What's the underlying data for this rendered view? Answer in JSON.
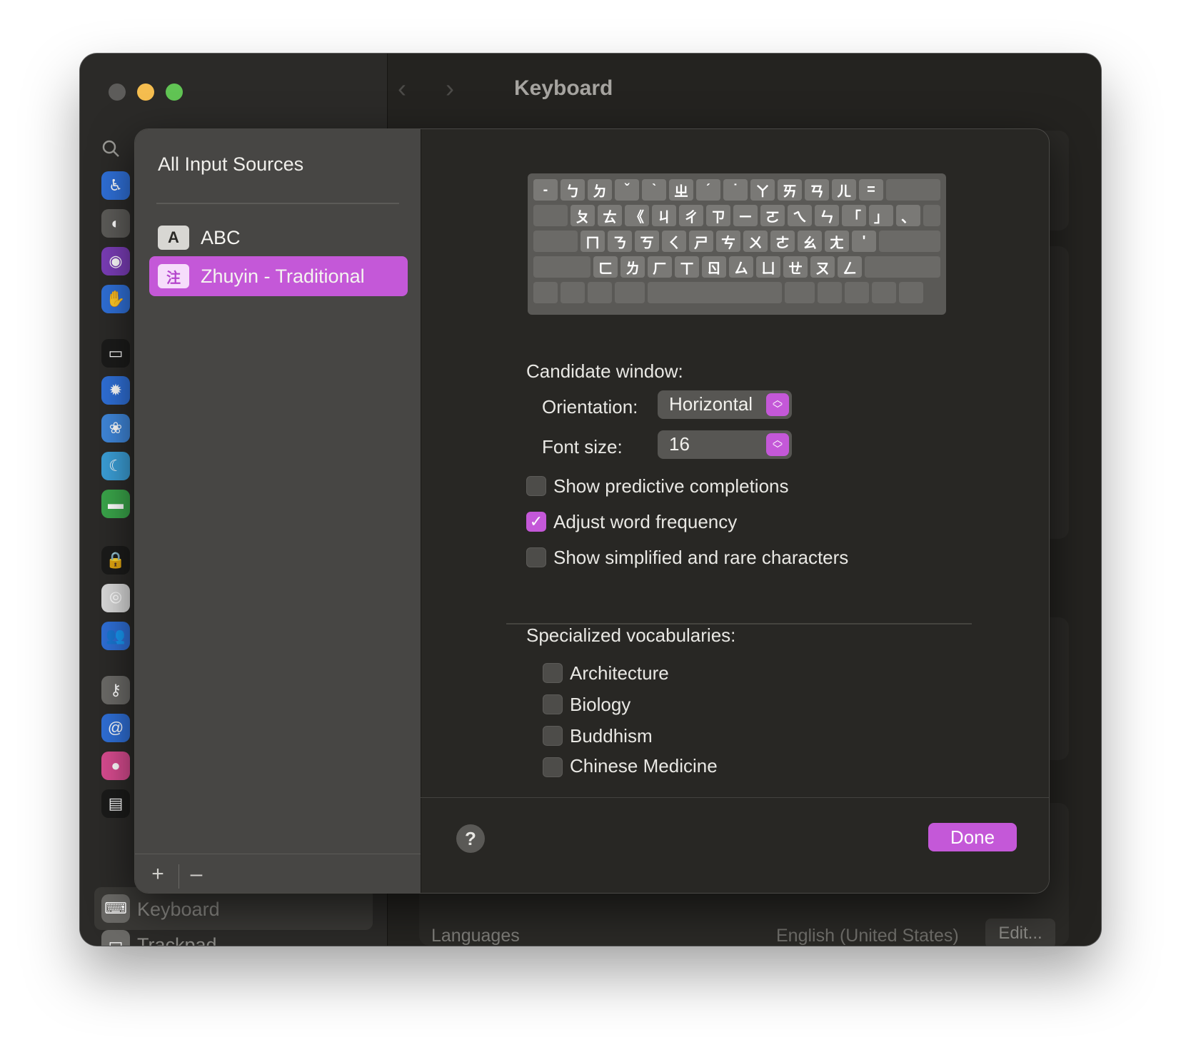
{
  "window": {
    "title": "Keyboard",
    "traffic_lights": {
      "close": "#5d5c5a",
      "minimize": "#f5bd4f",
      "maximize": "#61c454"
    },
    "accent_color": "#c458d8"
  },
  "sidebar": {
    "search_icon": "magnifier-icon",
    "icons": [
      {
        "name": "accessibility-icon",
        "glyph": "♿",
        "color": "#2f6fd6"
      },
      {
        "name": "control-center-icon",
        "glyph": "◐",
        "color": "#5c5b58"
      },
      {
        "name": "siri-icon",
        "glyph": "◉",
        "color": "#7a3db6"
      },
      {
        "name": "privacy-hand-icon",
        "glyph": "✋",
        "color": "#2f6fd6"
      },
      {
        "name": "desktop-dock-icon",
        "glyph": "▭",
        "color": "#1b1b1a"
      },
      {
        "name": "displays-icon",
        "glyph": "✹",
        "color": "#2f6fd6"
      },
      {
        "name": "wallpaper-icon",
        "glyph": "❀",
        "color": "#3f86d9"
      },
      {
        "name": "screen-saver-icon",
        "glyph": "☾",
        "color": "#3b9ed6"
      },
      {
        "name": "battery-icon",
        "glyph": "▬",
        "color": "#3aa54a"
      },
      {
        "name": "lock-screen-icon",
        "glyph": "🔒",
        "color": "#1b1b1a"
      },
      {
        "name": "touch-id-icon",
        "glyph": "⦾",
        "color": "#d9d9d9"
      },
      {
        "name": "users-groups-icon",
        "glyph": "👥",
        "color": "#2f6fd6"
      },
      {
        "name": "passwords-icon",
        "glyph": "⚷",
        "color": "#6b6a67"
      },
      {
        "name": "internet-accounts-icon",
        "glyph": "@",
        "color": "#2f6fd6"
      },
      {
        "name": "game-center-icon",
        "glyph": "●",
        "color": "#d74b8f"
      },
      {
        "name": "wallet-icon",
        "glyph": "▤",
        "color": "#1b1b1a"
      }
    ],
    "items": [
      {
        "label": "Keyboard",
        "icon": "keyboard-icon"
      },
      {
        "label": "Trackpad",
        "icon": "trackpad-icon"
      }
    ]
  },
  "background": {
    "languages_label": "Languages",
    "languages_value": "English (United States)",
    "edit_button": "Edit..."
  },
  "sheet": {
    "left": {
      "title": "All Input Sources",
      "sources": [
        {
          "badge": "A",
          "label": "ABC",
          "selected": false
        },
        {
          "badge": "注",
          "label": "Zhuyin - Traditional",
          "selected": true
        }
      ],
      "add_button": "+",
      "remove_button": "–"
    },
    "keyboard_rows": [
      [
        "-",
        "ㄅ",
        "ㄉ",
        "ˇ",
        "ˋ",
        "ㄓ",
        "ˊ",
        "˙",
        "ㄚ",
        "ㄞ",
        "ㄢ",
        "ㄦ",
        "="
      ],
      [
        "ㄆ",
        "ㄊ",
        "《",
        "ㄐ",
        "ㄔ",
        "ㄗ",
        "ㄧ",
        "ㄛ",
        "ㄟ",
        "ㄣ",
        "「",
        "」",
        "、"
      ],
      [
        "ㄇ",
        "ㄋ",
        "ㄎ",
        "ㄑ",
        "ㄕ",
        "ㄘ",
        "ㄨ",
        "ㄜ",
        "ㄠ",
        "ㄤ",
        "'"
      ],
      [
        "ㄈ",
        "ㄌ",
        "ㄏ",
        "ㄒ",
        "ㄖ",
        "ㄙ",
        "ㄩ",
        "ㄝ",
        "ㄡ",
        "ㄥ"
      ]
    ],
    "candidate_window": {
      "heading": "Candidate window:",
      "orientation_label": "Orientation:",
      "orientation_value": "Horizontal",
      "font_size_label": "Font size:",
      "font_size_value": "16"
    },
    "options": [
      {
        "label": "Show predictive completions",
        "checked": false
      },
      {
        "label": "Adjust word frequency",
        "checked": true
      },
      {
        "label": "Show simplified and rare characters",
        "checked": false
      }
    ],
    "vocabularies": {
      "heading": "Specialized vocabularies:",
      "items": [
        {
          "label": "Architecture",
          "checked": false
        },
        {
          "label": "Biology",
          "checked": false
        },
        {
          "label": "Buddhism",
          "checked": false
        },
        {
          "label": "Chinese Medicine",
          "checked": false
        }
      ]
    },
    "help_button": "?",
    "done_button": "Done"
  }
}
